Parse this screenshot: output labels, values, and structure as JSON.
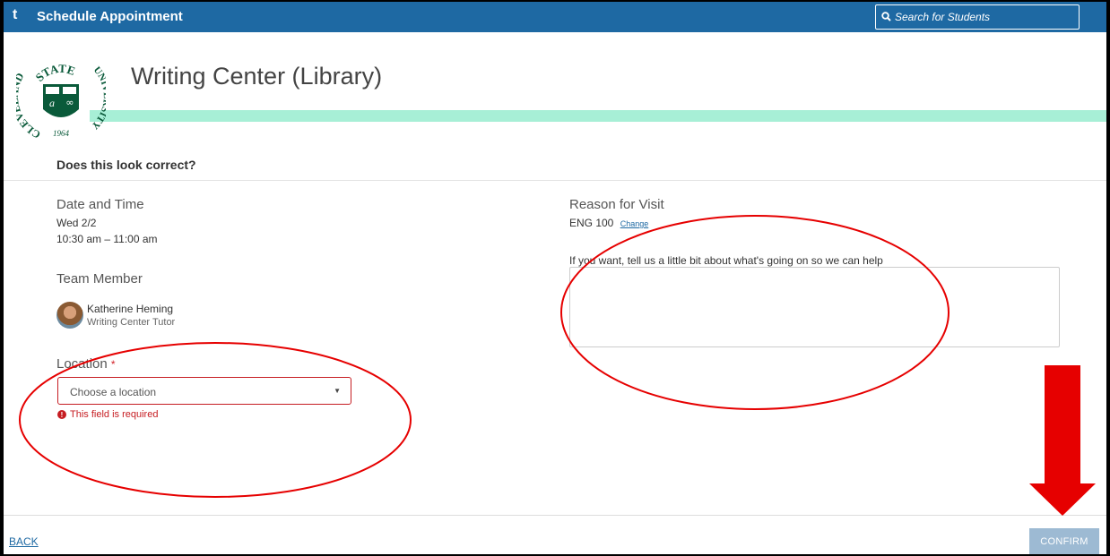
{
  "topbar": {
    "logo": "t",
    "title": "Schedule Appointment",
    "search_placeholder": "Search for Students"
  },
  "header": {
    "title": "Writing Center (Library)",
    "seal": {
      "top_text": "STATE",
      "left_text": "CLEVELAND",
      "right_text": "UNIVERSITY",
      "year": "1964",
      "color": "#0a5a3a"
    },
    "accent_color": "#a7efd6"
  },
  "confirm_section": {
    "question": "Does this look correct?"
  },
  "date_time": {
    "label": "Date and Time",
    "day": "Wed 2/2",
    "time": "10:30 am – 11:00 am"
  },
  "team_member": {
    "label": "Team Member",
    "name": "Katherine Heming",
    "role": "Writing Center Tutor"
  },
  "location": {
    "label": "Location",
    "required_mark": "*",
    "placeholder": "Choose a location",
    "error": "This field is required"
  },
  "reason": {
    "label": "Reason for Visit",
    "value": "ENG 100",
    "change_link": "Change",
    "prompt": "If you want, tell us a little bit about what's going on so we can help",
    "notes_value": ""
  },
  "footer": {
    "back_label": "BACK",
    "confirm_label": "CONFIRM"
  },
  "colors": {
    "topbar": "#1e69a3",
    "error": "#c61d22",
    "confirm_disabled": "#9dbad3",
    "annotation": "#e60000"
  }
}
